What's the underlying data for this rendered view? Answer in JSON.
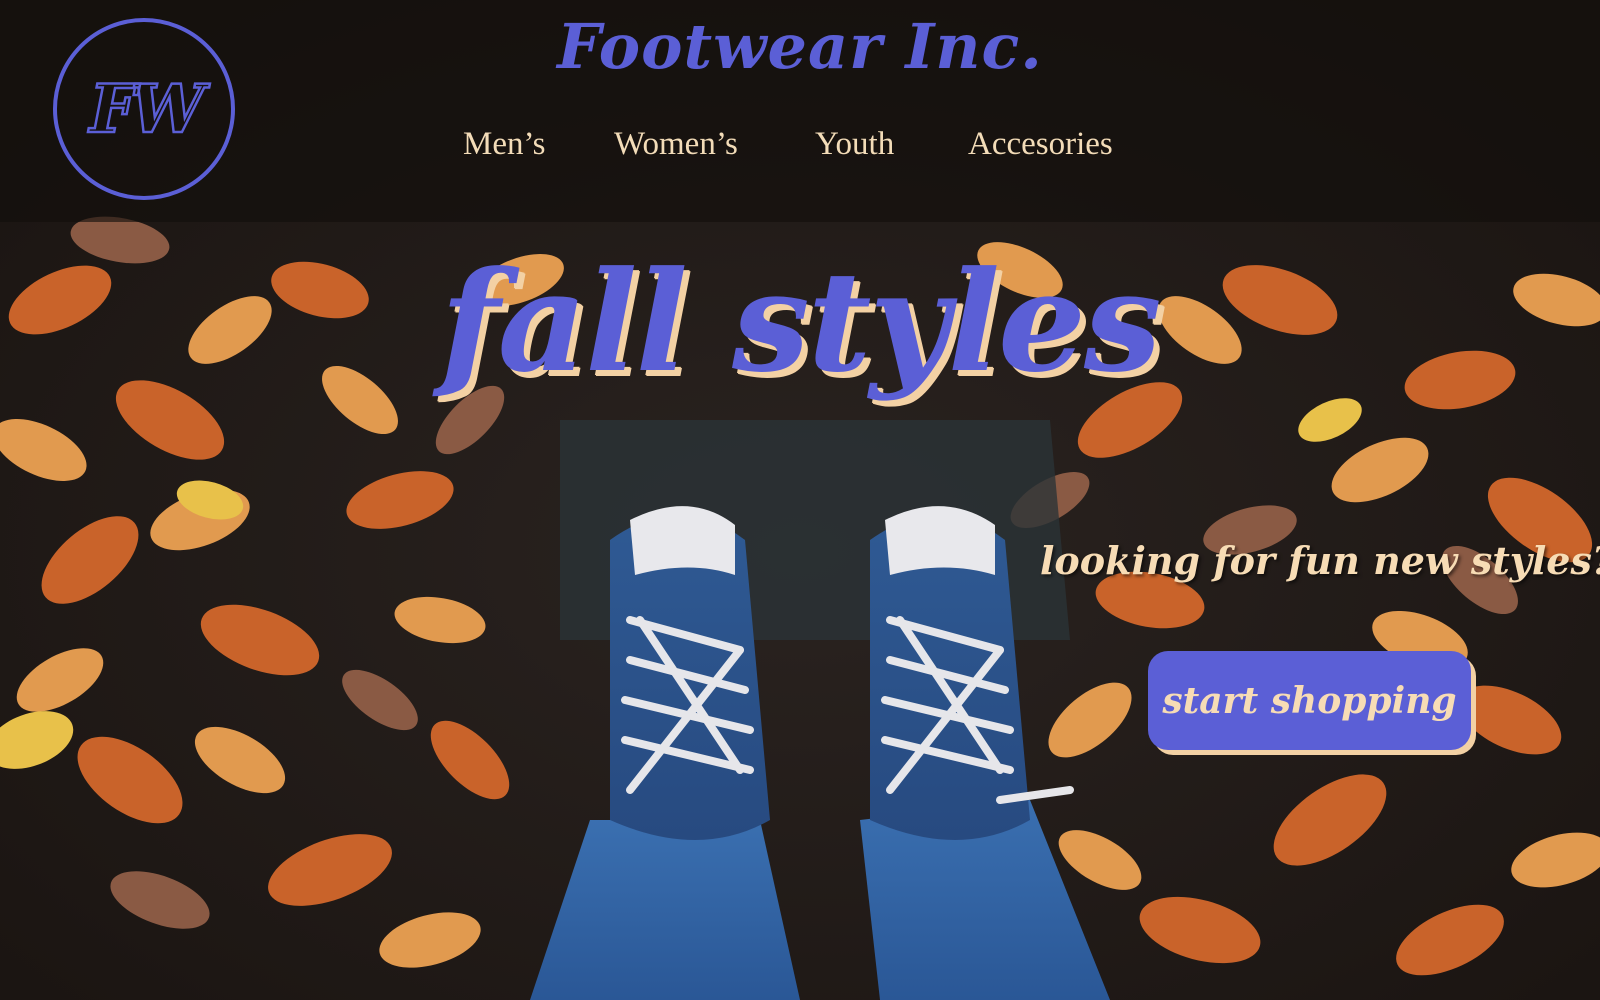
{
  "header": {
    "logo_text": "FW",
    "brand_name": "Footwear Inc.",
    "nav": [
      {
        "label": "Men’s"
      },
      {
        "label": "Women’s"
      },
      {
        "label": "Youth"
      },
      {
        "label": "Accesories"
      }
    ]
  },
  "hero": {
    "title": "fall styles",
    "tagline": "looking for fun new styles?",
    "cta_label": "start shopping"
  },
  "colors": {
    "accent": "#5b5fd6",
    "cream": "#f3d1a4",
    "nav_text": "#f3dcb8"
  }
}
